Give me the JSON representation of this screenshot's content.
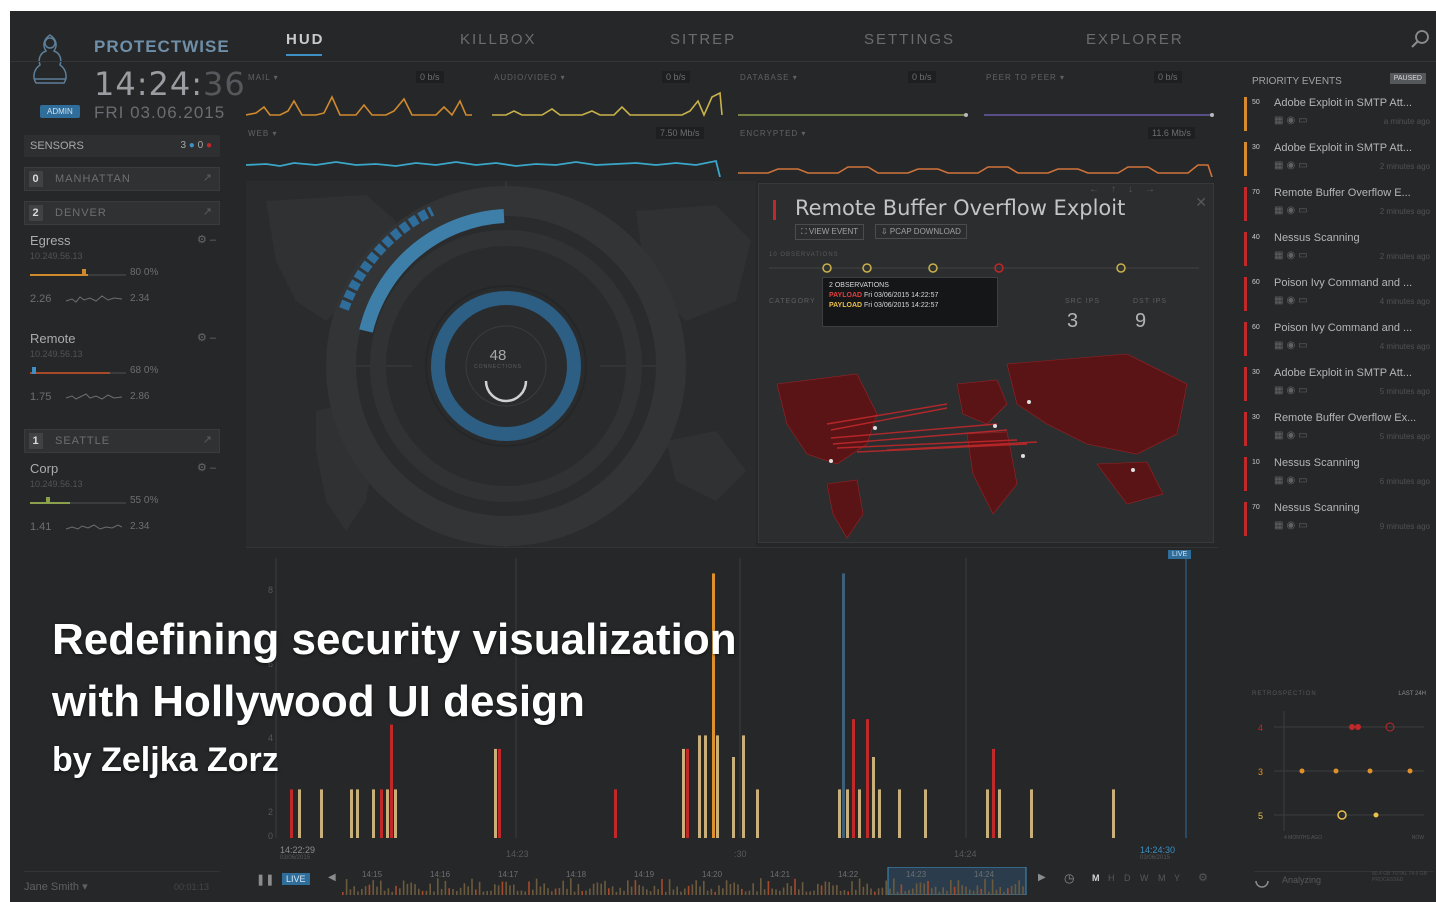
{
  "brand": {
    "name": "PROTECTWISE",
    "clock_main": "14:24:",
    "clock_seconds": "36",
    "role_badge": "ADMIN",
    "date": "FRI  03.06.2015"
  },
  "nav": {
    "tabs": [
      "HUD",
      "KILLBOX",
      "SITREP",
      "SETTINGS",
      "EXPLORER"
    ],
    "active": "HUD"
  },
  "sidebar": {
    "sensors_label": "SENSORS",
    "sensors_count": "3",
    "sensors_alerts": "0",
    "locations": [
      {
        "num": "0",
        "name": "MANHATTAN"
      },
      {
        "num": "2",
        "name": "DENVER"
      },
      {
        "num": "1",
        "name": "SEATTLE"
      }
    ],
    "sensors": [
      {
        "name": "Egress",
        "ip": "10.249.56.13",
        "v1": "80   0%",
        "v2": "2.26",
        "v3": "2.34"
      },
      {
        "name": "Remote",
        "ip": "10.249.56.13",
        "v1": "68   0%",
        "v2": "1.75",
        "v3": "2.86"
      },
      {
        "name": "Corp",
        "ip": "10.249.56.13",
        "v1": "55   0%",
        "v2": "1.41",
        "v3": "2.34"
      }
    ],
    "user": "Jane Smith ▾",
    "uptime": "00:01:13"
  },
  "metrics": [
    {
      "label": "MAIL ▾",
      "value": "0",
      "unit": "b/s",
      "color": "#d88a2e"
    },
    {
      "label": "AUDIO/VIDEO ▾",
      "value": "0",
      "unit": "b/s",
      "color": "#c9b24a"
    },
    {
      "label": "DATABASE ▾",
      "value": "0",
      "unit": "b/s",
      "color": "#8aa04a"
    },
    {
      "label": "PEER TO PEER ▾",
      "value": "0",
      "unit": "b/s",
      "color": "#6a5aa8"
    },
    {
      "label": "WEB ▾",
      "value": "7.50",
      "unit": "Mb/s",
      "color": "#3aa6c8"
    },
    {
      "label": "ENCRYPTED ▾",
      "value": "11.6",
      "unit": "Mb/s",
      "color": "#d0733a"
    }
  ],
  "radial": {
    "connections": "48",
    "connections_label": "CONNECTIONS"
  },
  "popup": {
    "title": "Remote Buffer Overflow Exploit",
    "view_event": "⛶ VIEW EVENT",
    "pcap_download": "⇩ PCAP DOWNLOAD",
    "observations_label": "10 OBSERVATIONS",
    "src_ips_label": "SRC IPS",
    "src_ips": "3",
    "dst_ips_label": "DST IPS",
    "dst_ips": "9",
    "category_label": "CATEGORY",
    "tooltip": {
      "title": "2 OBSERVATIONS",
      "row1_key": "PAYLOAD",
      "row1_val": "Fri 03/06/2015 14:22:57",
      "row2_key": "PAYLOAD",
      "row2_val": "Fri 03/06/2015 14:22:57"
    }
  },
  "priority": {
    "title": "PRIORITY EVENTS",
    "status": "PAUSED",
    "events": [
      {
        "score": "50",
        "title": "Adobe Exploit in SMTP Att...",
        "ago": "a minute ago",
        "color": "#d88a2e"
      },
      {
        "score": "30",
        "title": "Adobe Exploit in SMTP Att...",
        "ago": "2 minutes ago",
        "color": "#d88a2e"
      },
      {
        "score": "70",
        "title": "Remote Buffer Overflow E...",
        "ago": "2 minutes ago",
        "color": "#c0282a"
      },
      {
        "score": "40",
        "title": "Nessus Scanning",
        "ago": "2 minutes ago",
        "color": "#c0282a"
      },
      {
        "score": "60",
        "title": "Poison Ivy Command and ...",
        "ago": "4 minutes ago",
        "color": "#c0282a"
      },
      {
        "score": "60",
        "title": "Poison Ivy Command and ...",
        "ago": "4 minutes ago",
        "color": "#c0282a"
      },
      {
        "score": "30",
        "title": "Adobe Exploit in SMTP Att...",
        "ago": "5 minutes ago",
        "color": "#c0282a"
      },
      {
        "score": "30",
        "title": "Remote Buffer Overflow Ex...",
        "ago": "5 minutes ago",
        "color": "#c0282a"
      },
      {
        "score": "10",
        "title": "Nessus Scanning",
        "ago": "6 minutes ago",
        "color": "#c0282a"
      },
      {
        "score": "70",
        "title": "Nessus Scanning",
        "ago": "9 minutes ago",
        "color": "#c0282a"
      }
    ]
  },
  "retro": {
    "label": "RETROSPECTION",
    "range": "LAST 24H",
    "rows": [
      "4",
      "3",
      "5"
    ],
    "left_axis": "4 MONTHS AGO",
    "right_axis": "NOW",
    "status": "Analyzing",
    "processed": "80.4 GB TOTAL 74.6 GB PROCESSED"
  },
  "timeline": {
    "live": "LIVE",
    "start_time": "14:22:29",
    "start_date": "03/06/2015",
    "end_time": "14:24:30",
    "end_date": "03/06/2015",
    "ticks": [
      "14:23",
      ":30",
      "14:24"
    ],
    "scrub_ticks": [
      "14:15",
      "14:16",
      "14:17",
      "14:18",
      "14:19",
      "14:20",
      "14:21",
      "14:22",
      "14:23",
      "14:24"
    ],
    "ranges": [
      "M",
      "H",
      "D",
      "W",
      "M",
      "Y"
    ],
    "y_ticks": [
      "8",
      "6",
      "4",
      "2",
      "0"
    ]
  },
  "headline": {
    "line1": "Redefining security visualization",
    "line2": "with Hollywood UI design",
    "byline": "by Zeljka Zorz"
  },
  "colors": {
    "accent_blue": "#3d8fc4",
    "alert_red": "#c0282a",
    "bar_tan": "#c9b07a",
    "bar_orange": "#e0902a"
  }
}
